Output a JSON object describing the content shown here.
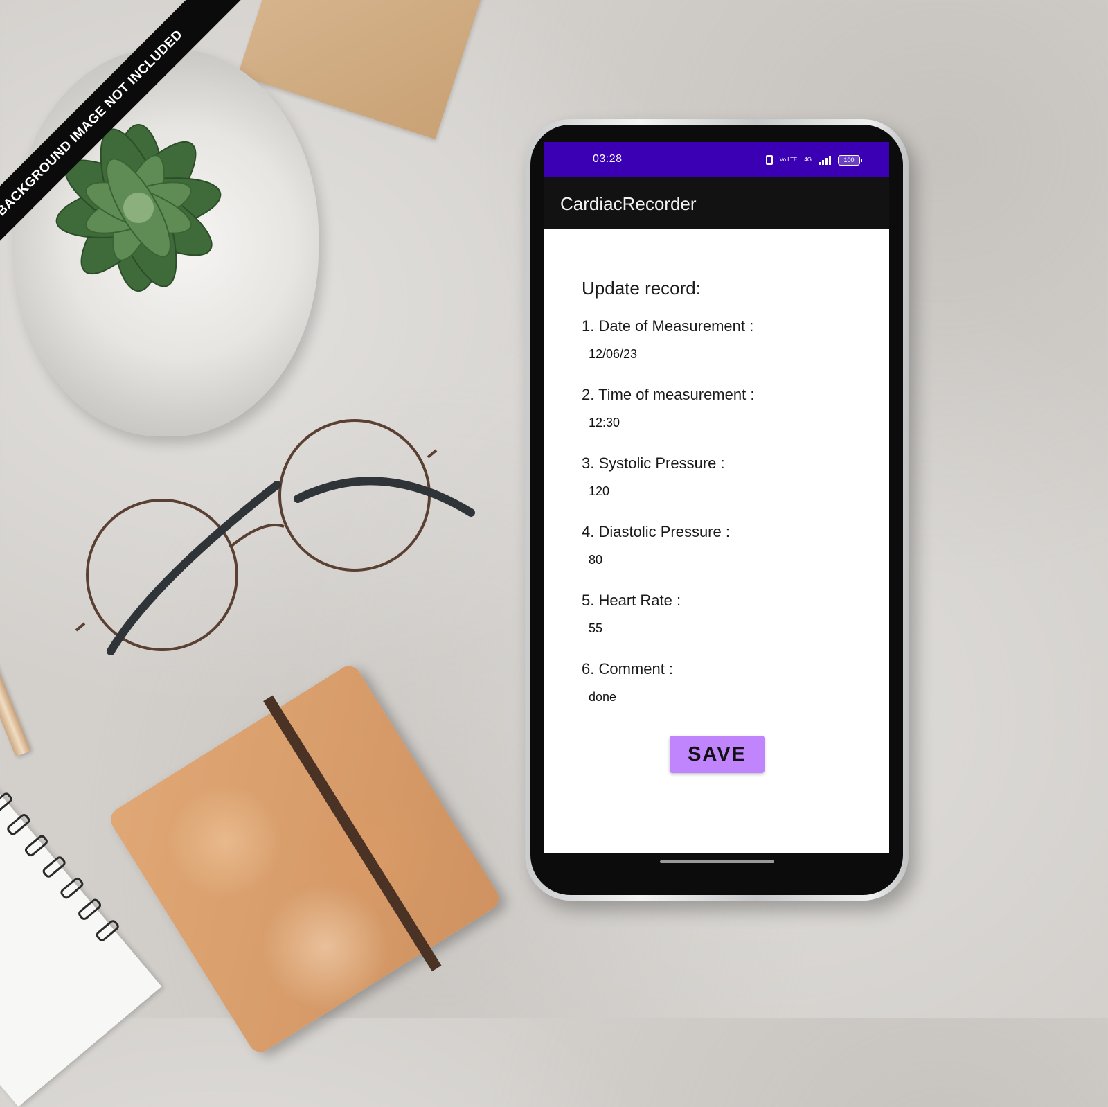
{
  "scene": {
    "banner_text": "BACKGROUND IMAGE NOT INCLUDED"
  },
  "status_bar": {
    "time": "03:28",
    "network": "4G",
    "volte": "Vo LTE",
    "battery": "100",
    "color": "#3b00b3"
  },
  "app_bar": {
    "title": "CardiacRecorder",
    "color": "#121212"
  },
  "form": {
    "heading": "Update record:",
    "fields": [
      {
        "label": "1. Date of Measurement :",
        "value": "12/06/23"
      },
      {
        "label": "2. Time of measurement :",
        "value": "12:30"
      },
      {
        "label": "3. Systolic Pressure :",
        "value": "120"
      },
      {
        "label": "4. Diastolic Pressure :",
        "value": "80"
      },
      {
        "label": "5. Heart Rate :",
        "value": "55"
      },
      {
        "label": "6. Comment :",
        "value": "done"
      }
    ],
    "save_label": "SAVE",
    "save_color": "#c084fc"
  }
}
